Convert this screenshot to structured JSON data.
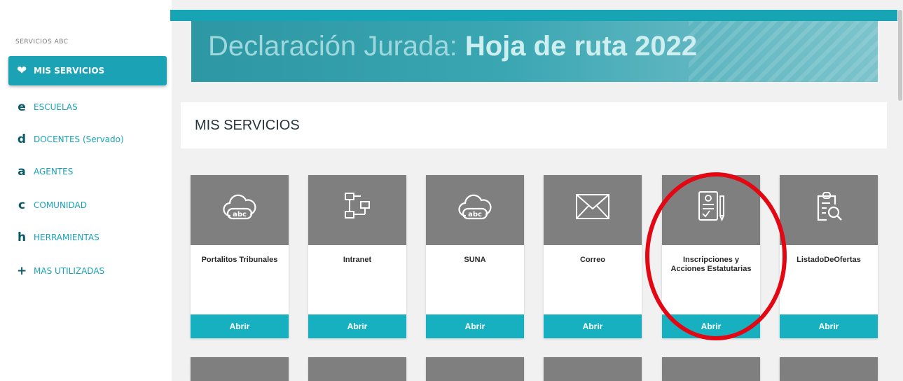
{
  "sidebar": {
    "title": "SERVICIOS ABC",
    "items": [
      {
        "letter": "❤",
        "label": "MIS SERVICIOS",
        "active": true
      },
      {
        "letter": "e",
        "label": "ESCUELAS"
      },
      {
        "letter": "d",
        "label": "DOCENTES (Servado)"
      },
      {
        "letter": "a",
        "label": "AGENTES"
      },
      {
        "letter": "c",
        "label": "COMUNIDAD"
      },
      {
        "letter": "h",
        "label": "HERRAMIENTAS"
      },
      {
        "letter": "+",
        "label": "MAS UTILIZADAS"
      }
    ]
  },
  "banner": {
    "text_regular": "Declaración Jurada: ",
    "text_bold": "Hoja de ruta 2022"
  },
  "section": {
    "title": "MIS SERVICIOS"
  },
  "cards": [
    {
      "label": "Portalitos Tribunales",
      "button": "Abrir",
      "icon": "cloud-abc-icon"
    },
    {
      "label": "Intranet",
      "button": "Abrir",
      "icon": "network-icon"
    },
    {
      "label": "SUNA",
      "button": "Abrir",
      "icon": "cloud-abc-icon"
    },
    {
      "label": "Correo",
      "button": "Abrir",
      "icon": "envelope-icon"
    },
    {
      "label": "Inscripciones y Acciones Estatutarias",
      "button": "Abrir",
      "icon": "document-form-icon"
    },
    {
      "label": "ListadoDeOfertas",
      "button": "Abrir",
      "icon": "clipboard-search-icon"
    }
  ],
  "colors": {
    "accent": "#17b0c1",
    "card_top": "#7f7f7f",
    "highlight": "#e30613"
  }
}
